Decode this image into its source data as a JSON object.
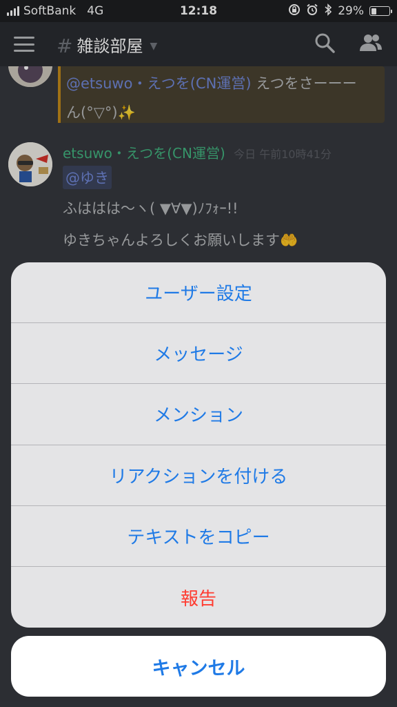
{
  "status_bar": {
    "carrier": "SoftBank",
    "network": "4G",
    "time": "12:18",
    "battery": "29%",
    "battery_level": 0.29
  },
  "header": {
    "channel_name": "雑談部屋",
    "icons": [
      "hamburger-icon",
      "hash-icon",
      "search-icon",
      "members-icon"
    ]
  },
  "chat": {
    "quoted_message": {
      "mention": "@etsuwo・えつを(CN運営)",
      "text_line1": "えつをさーーー",
      "text_line2": "ん(°▽°)✨"
    },
    "message": {
      "username": "etsuwo・えつを(CN運営)",
      "timestamp": "今日 午前10時41分",
      "mention": "@ゆき",
      "line1": "ふははは〜ヽ( ▼∀▼)ﾉﾌｫｰ!!",
      "line2": "ゆきちゃんよろしくお願いします🤲"
    }
  },
  "action_sheet": {
    "items": [
      {
        "label": "ユーザー設定"
      },
      {
        "label": "メッセージ"
      },
      {
        "label": "メンション"
      },
      {
        "label": "リアクションを付ける"
      },
      {
        "label": "テキストをコピー"
      },
      {
        "label": "報告"
      }
    ],
    "cancel_label": "キャンセル"
  },
  "colors": {
    "accent": "#1f7ae6",
    "destructive": "#ff3b30",
    "username": "#43b581",
    "mention": "#7289da",
    "background": "#36393f"
  }
}
